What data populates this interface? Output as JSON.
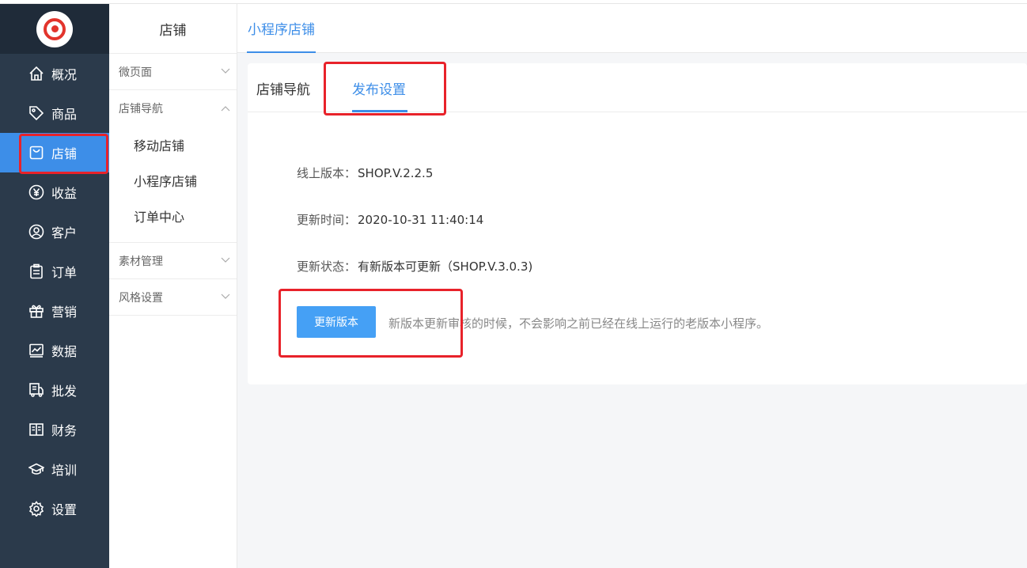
{
  "sidebar": {
    "items": [
      {
        "label": "概况",
        "icon": "home-icon"
      },
      {
        "label": "商品",
        "icon": "tag-icon"
      },
      {
        "label": "店铺",
        "icon": "shopping-bag-icon",
        "active": true
      },
      {
        "label": "收益",
        "icon": "yen-circle-icon"
      },
      {
        "label": "客户",
        "icon": "user-circle-icon"
      },
      {
        "label": "订单",
        "icon": "clipboard-icon"
      },
      {
        "label": "营销",
        "icon": "gift-icon"
      },
      {
        "label": "数据",
        "icon": "chart-icon"
      },
      {
        "label": "批发",
        "icon": "truck-icon"
      },
      {
        "label": "财务",
        "icon": "ledger-icon"
      },
      {
        "label": "培训",
        "icon": "graduation-cap-icon"
      },
      {
        "label": "设置",
        "icon": "gear-icon"
      }
    ]
  },
  "subnav": {
    "title": "店铺",
    "groups": [
      {
        "label": "微页面",
        "expanded": false
      },
      {
        "label": "店铺导航",
        "expanded": true,
        "items": [
          "移动店铺",
          "小程序店铺",
          "订单中心"
        ]
      },
      {
        "label": "素材管理",
        "expanded": false
      },
      {
        "label": "风格设置",
        "expanded": false
      }
    ]
  },
  "main": {
    "header_tab": "小程序店铺",
    "tabs": [
      "店铺导航",
      "发布设置"
    ],
    "active_tab": "发布设置",
    "fields": {
      "online_version_label": "线上版本：",
      "online_version_value": "SHOP.V.2.2.5",
      "update_time_label": "更新时间：",
      "update_time_value": "2020-10-31 11:40:14",
      "update_status_label": "更新状态：",
      "update_status_value": "有新版本可更新（SHOP.V.3.0.3)"
    },
    "update_button": "更新版本",
    "note": "新版本更新审核的时候，不会影响之前已经在线上运行的老版本小程序。"
  },
  "colors": {
    "sidebar_bg": "#2b3a4b",
    "accent": "#3d8ee8",
    "highlight_box": "#e8222a"
  }
}
